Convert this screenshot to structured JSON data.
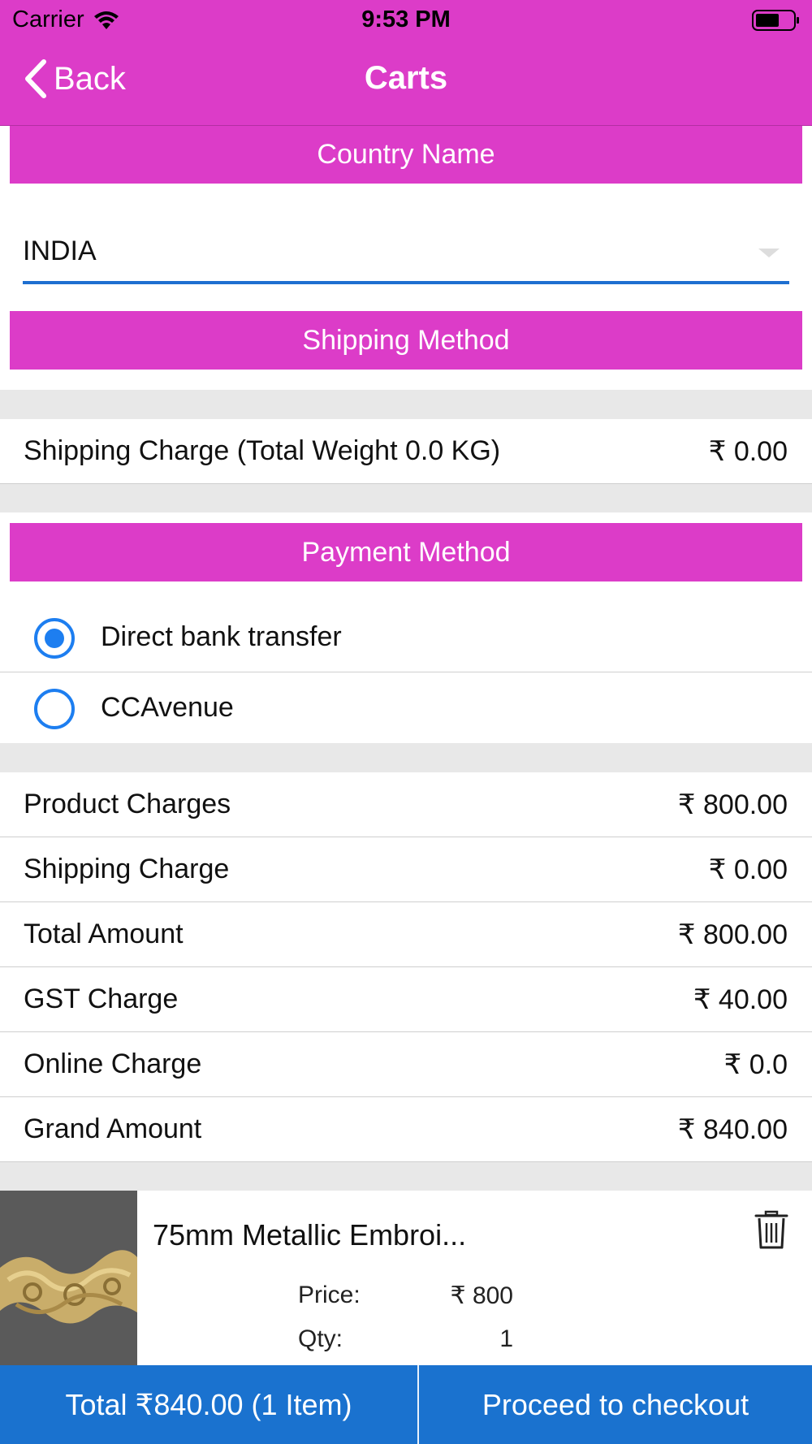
{
  "status_bar": {
    "carrier": "Carrier",
    "time": "9:53 PM"
  },
  "nav": {
    "back_label": "Back",
    "title": "Carts"
  },
  "country": {
    "header": "Country Name",
    "selected": "INDIA"
  },
  "shipping": {
    "header": "Shipping Method",
    "label": "Shipping Charge (Total Weight 0.0 KG)",
    "value": "₹ 0.00"
  },
  "payment": {
    "header": "Payment Method",
    "options": [
      {
        "label": "Direct bank transfer",
        "selected": true
      },
      {
        "label": "CCAvenue",
        "selected": false
      }
    ]
  },
  "summary": [
    {
      "label": "Product Charges",
      "value": "₹ 800.00"
    },
    {
      "label": "Shipping Charge",
      "value": "₹ 0.00"
    },
    {
      "label": "Total Amount",
      "value": "₹ 800.00"
    },
    {
      "label": "GST Charge",
      "value": "₹ 40.00"
    },
    {
      "label": "Online Charge",
      "value": "₹ 0.0"
    },
    {
      "label": "Grand Amount",
      "value": "₹ 840.00"
    }
  ],
  "cart_item": {
    "title": "75mm Metallic Embroi...",
    "price_label": "Price:",
    "price_value": "₹ 800",
    "qty_label": "Qty:",
    "qty_value": "1"
  },
  "footer": {
    "total_label": "Total ₹840.00 (1 Item)",
    "checkout_label": "Proceed to checkout"
  },
  "colors": {
    "brand": "#dc3cc8",
    "accent": "#1a72cf",
    "radio": "#1d7ef0"
  }
}
